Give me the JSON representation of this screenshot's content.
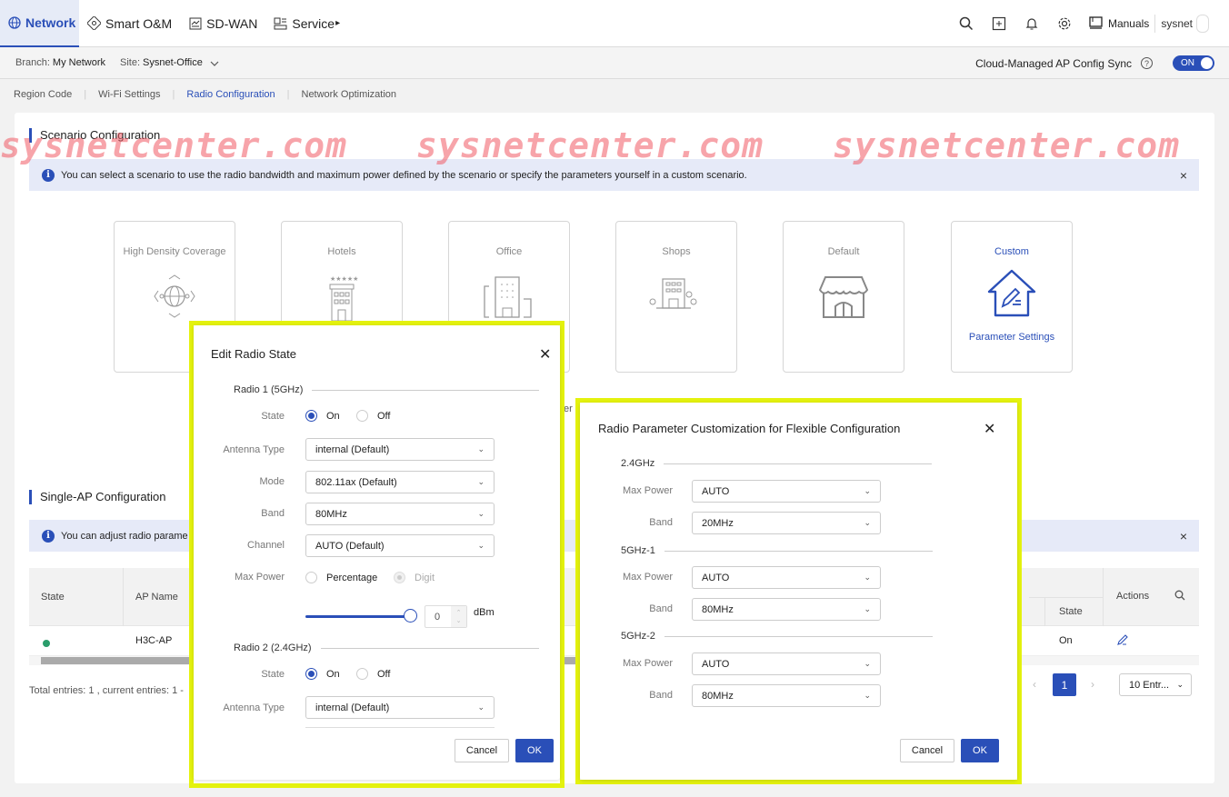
{
  "topnav": {
    "items": [
      {
        "label": "Network",
        "icon": "globe-icon",
        "active": true
      },
      {
        "label": "Smart O&M",
        "icon": "satellite-icon"
      },
      {
        "label": "SD-WAN",
        "icon": "chart-box-icon"
      },
      {
        "label": "Service",
        "icon": "panel-icon",
        "caret": "▸"
      }
    ],
    "manuals_label": "Manuals",
    "user": "sysnet"
  },
  "branchbar": {
    "branch_label": "Branch:",
    "branch_value": "My Network",
    "site_label": "Site:",
    "site_value": "Sysnet-Office",
    "sync_label": "Cloud-Managed AP Config Sync",
    "sync_toggle": "ON"
  },
  "subtabs": [
    {
      "label": "Region Code"
    },
    {
      "label": "Wi-Fi Settings"
    },
    {
      "label": "Radio Configuration",
      "active": true
    },
    {
      "label": "Network Optimization"
    }
  ],
  "watermark": "sysnetcenter.com",
  "scenario": {
    "title": "Scenario Configuration",
    "banner": "You can select a scenario to use the radio bandwidth and maximum power defined by the scenario or specify the parameters yourself in a custom scenario.",
    "cards": [
      {
        "label": "High Density Coverage"
      },
      {
        "label": "Hotels"
      },
      {
        "label": "Office"
      },
      {
        "label": "Shops"
      },
      {
        "label": "Default"
      },
      {
        "label": "Custom",
        "sub": "Parameter Settings"
      }
    ],
    "partial_text": "er"
  },
  "single_ap": {
    "title": "Single-AP Configuration",
    "banner": "You can adjust radio parame",
    "columns": {
      "state": "State",
      "ap_name": "AP Name",
      "radio_state": "State",
      "actions": "Actions"
    },
    "rows": [
      {
        "state": "online",
        "ap_name": "H3C-AP",
        "radio_state": "On"
      }
    ],
    "footer": "Total entries: 1 , current entries: 1 -",
    "page": "1",
    "entries": "10 Entr..."
  },
  "edit_radio": {
    "title": "Edit Radio State",
    "radio1": {
      "label": "Radio 1 (5GHz)",
      "state_label": "State",
      "on": "On",
      "off": "Off",
      "state": "On",
      "antenna_label": "Antenna Type",
      "antenna": "internal (Default)",
      "mode_label": "Mode",
      "mode": "802.11ax (Default)",
      "band_label": "Band",
      "band": "80MHz",
      "channel_label": "Channel",
      "channel": "AUTO (Default)",
      "power_label": "Max Power",
      "percentage": "Percentage",
      "digit": "Digit",
      "power_value": "0",
      "power_unit": "dBm",
      "slider_fraction": 1.0
    },
    "radio2": {
      "label": "Radio 2 (2.4GHz)",
      "state_label": "State",
      "on": "On",
      "off": "Off",
      "state": "On",
      "antenna_label": "Antenna Type",
      "antenna": "internal (Default)"
    },
    "cancel": "Cancel",
    "ok": "OK"
  },
  "custom_dialog": {
    "title": "Radio Parameter Customization for Flexible Configuration",
    "groups": [
      {
        "label": "2.4GHz",
        "power_label": "Max Power",
        "power": "AUTO",
        "band_label": "Band",
        "band": "20MHz"
      },
      {
        "label": "5GHz-1",
        "power_label": "Max Power",
        "power": "AUTO",
        "band_label": "Band",
        "band": "80MHz"
      },
      {
        "label": "5GHz-2",
        "power_label": "Max Power",
        "power": "AUTO",
        "band_label": "Band",
        "band": "80MHz"
      }
    ],
    "cancel": "Cancel",
    "ok": "OK"
  }
}
